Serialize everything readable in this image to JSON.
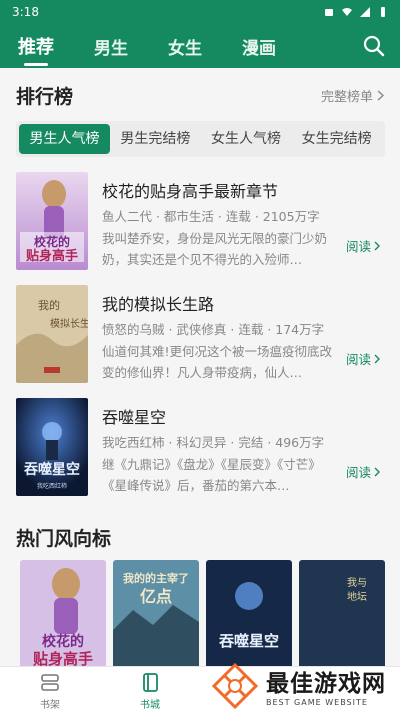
{
  "status_bar": {
    "time": "3:18"
  },
  "top_nav": {
    "tabs": [
      {
        "label": "推荐",
        "active": true
      },
      {
        "label": "男生",
        "active": false
      },
      {
        "label": "女生",
        "active": false
      },
      {
        "label": "漫画",
        "active": false
      }
    ]
  },
  "ranking": {
    "title": "排行榜",
    "more": "完整榜单",
    "tabs": [
      "男生人气榜",
      "男生完结榜",
      "女生人气榜",
      "女生完结榜"
    ],
    "books": [
      {
        "title": "校花的贴身高手最新章节",
        "meta": "鱼人二代 · 都市生活 · 连载 · 2105万字",
        "desc": "我叫楚乔安，身份是风光无限的豪门少奶奶，其实还是个见不得光的入殓师…",
        "read": "阅读",
        "cover_text": "校花的贴身高手"
      },
      {
        "title": "我的模拟长生路",
        "meta": "愤怒的乌贼 · 武侠修真 · 连载 · 174万字",
        "desc": "仙道何其难!更何况这个被一场瘟疫彻底改变的修仙界！凡人身带疫病，仙人…",
        "read": "阅读",
        "cover_text": "我的模拟长生路"
      },
      {
        "title": "吞噬星空",
        "meta": "我吃西红柿 · 科幻灵异 · 完结 · 496万字",
        "desc": "继《九鼎记》《盘龙》《星辰变》《寸芒》《星峰传说》后，番茄的第六本…",
        "read": "阅读",
        "cover_text": "吞噬星空"
      }
    ]
  },
  "hot": {
    "title": "热门风向标",
    "covers": [
      "校花的贴身高手",
      "我的的主宰了亿点",
      "吞噬星空",
      "我与地坛"
    ]
  },
  "bottom_bar": {
    "items": [
      {
        "label": "书架"
      },
      {
        "label": "书城"
      }
    ]
  },
  "watermark": {
    "main": "最佳游戏网",
    "sub": "BEST GAME WEBSITE"
  },
  "colors": {
    "brand": "#158a61"
  }
}
